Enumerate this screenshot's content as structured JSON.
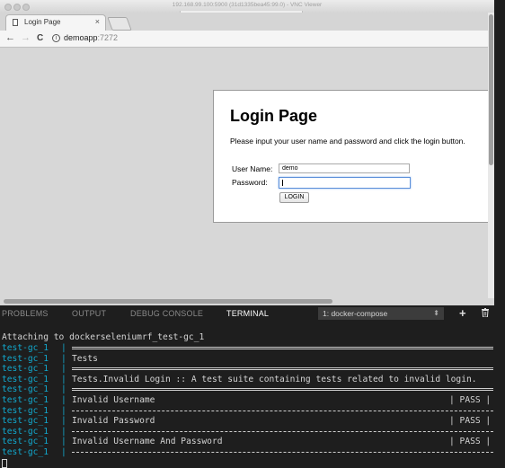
{
  "vnc": {
    "title": "192.168.99.100:5900 (31d1335bea45:99.0) - VNC Viewer"
  },
  "browser": {
    "tab_title": "Login Page",
    "tab_close": "×",
    "url_host": "demoapp",
    "url_port": ":7272",
    "back_icon": "←",
    "forward_icon": "→",
    "reload_icon": "C"
  },
  "login_page": {
    "title": "Login Page",
    "description": "Please input your user name and password and click the login button.",
    "username_label": "User Name:",
    "username_value": "demo",
    "password_label": "Password:",
    "login_button": "LOGIN"
  },
  "panel": {
    "tabs": [
      "PROBLEMS",
      "OUTPUT",
      "DEBUG CONSOLE",
      "TERMINAL"
    ],
    "active_tab": "TERMINAL",
    "terminal_select": "1: docker-compose",
    "add_icon": "+"
  },
  "terminal": {
    "attach_line": "Attaching to dockerseleniumrf_test-gc_1",
    "prefix": "test-gc_1",
    "separator": "|",
    "rows": [
      {
        "kind": "double"
      },
      {
        "kind": "text",
        "text": "Tests"
      },
      {
        "kind": "double"
      },
      {
        "kind": "text",
        "text": "Tests.Invalid Login :: A test suite containing tests related to invalid login."
      },
      {
        "kind": "double"
      },
      {
        "kind": "text",
        "text": "Invalid Username",
        "status": "| PASS |"
      },
      {
        "kind": "single"
      },
      {
        "kind": "text",
        "text": "Invalid Password",
        "status": "| PASS |"
      },
      {
        "kind": "single"
      },
      {
        "kind": "text",
        "text": "Invalid Username And Password",
        "status": "| PASS |"
      },
      {
        "kind": "single"
      }
    ]
  },
  "colors": {
    "terminal_prefix": "#11a8cd",
    "terminal_bg": "#1e1e1e",
    "focus_border": "#5b8fd9"
  }
}
